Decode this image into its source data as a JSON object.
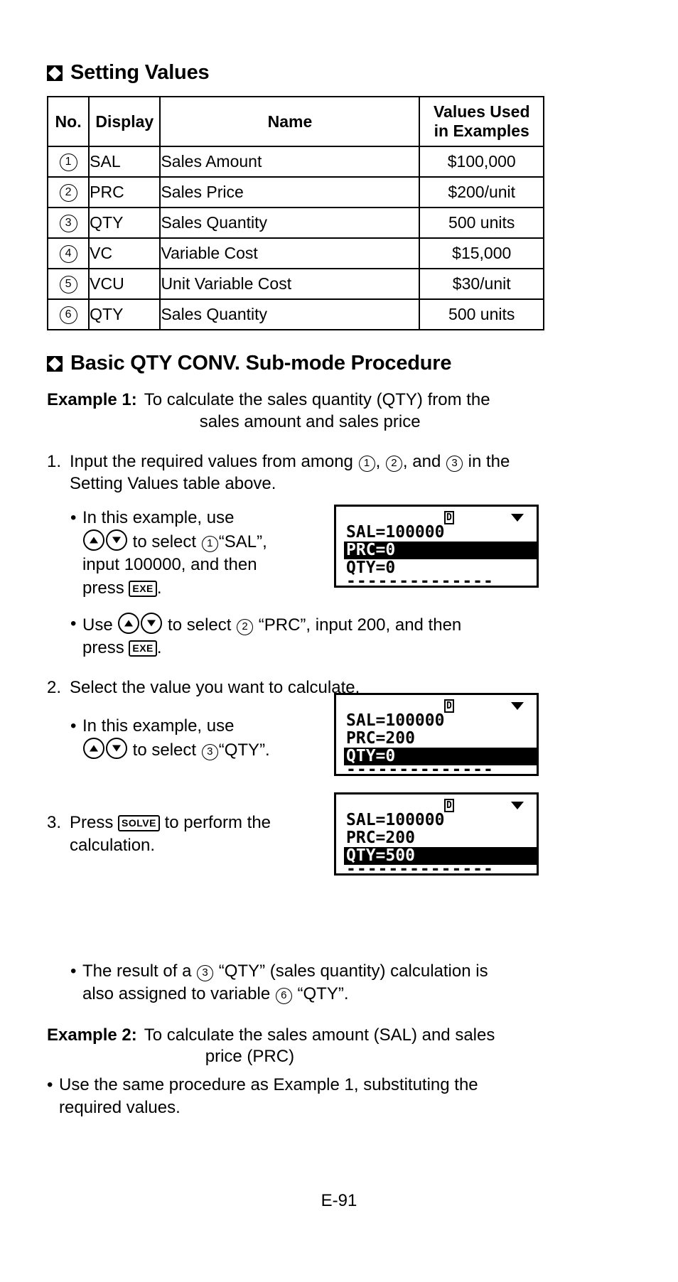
{
  "headings": {
    "setting_values": "Setting Values",
    "basic_procedure": "Basic QTY CONV. Sub-mode Procedure"
  },
  "table": {
    "columns": [
      "No.",
      "Display",
      "Name",
      "Values Used in Examples"
    ],
    "col_values_line1": "Values Used",
    "col_values_line2": "in Examples",
    "col_no": "No.",
    "col_display": "Display",
    "col_name": "Name",
    "rows": [
      {
        "no": "1",
        "display": "SAL",
        "name": "Sales Amount",
        "value": "$100,000"
      },
      {
        "no": "2",
        "display": "PRC",
        "name": "Sales Price",
        "value": "$200/unit"
      },
      {
        "no": "3",
        "display": "QTY",
        "name": "Sales Quantity",
        "value": "500 units"
      },
      {
        "no": "4",
        "display": "VC",
        "name": "Variable Cost",
        "value": "$15,000"
      },
      {
        "no": "5",
        "display": "VCU",
        "name": "Unit Variable Cost",
        "value": "$30/unit"
      },
      {
        "no": "6",
        "display": "QTY",
        "name": "Sales Quantity",
        "value": "500 units"
      }
    ]
  },
  "example1": {
    "label": "Example 1:",
    "text_line1": "To calculate the sales quantity (QTY) from the",
    "text_line2": "sales amount and sales price"
  },
  "step1": {
    "number": "1.",
    "text_before": "Input the required values from among",
    "circ_a": "1",
    "sep_a": ",",
    "circ_b": "2",
    "sep_b": ", and",
    "circ_c": "3",
    "text_after": "in the Setting Values table above."
  },
  "step1_bullet1": {
    "dot": "•",
    "seg1": "In this example, use",
    "key_up": "up-arrow",
    "key_down": "down-arrow",
    "seg2": "to select",
    "circ": "1",
    "seg3": "“SAL”,",
    "seg4": "input 100000, and then",
    "seg5": "press",
    "key_exe": "EXE",
    "seg6": "."
  },
  "step1_bullet2": {
    "dot": "•",
    "seg1": "Use",
    "key_up": "up-arrow",
    "key_down": "down-arrow",
    "seg2": "to select",
    "circ": "2",
    "seg3": "“PRC”, input 200, and then",
    "seg4": "press",
    "key_exe": "EXE",
    "seg5": "."
  },
  "step2": {
    "number": "2.",
    "text": "Select the value you want to calculate."
  },
  "step2_bullet": {
    "dot": "•",
    "seg1": "In this example, use",
    "key_up": "up-arrow",
    "key_down": "down-arrow",
    "seg2": "to select",
    "circ": "3",
    "seg3": "“QTY”."
  },
  "step3": {
    "number": "3.",
    "seg1": "Press",
    "key_solve": "SOLVE",
    "seg2": "to perform the",
    "seg3": "calculation."
  },
  "result_bullet": {
    "dot": "•",
    "seg1": "The result of a",
    "circ1": "3",
    "seg2": "“QTY” (sales quantity) calculation is",
    "seg3": "also assigned to variable",
    "circ2": "6",
    "seg4": "“QTY”."
  },
  "example2": {
    "label": "Example 2:",
    "text_line1": "To calculate the sales amount (SAL) and sales",
    "text_line2": "price (PRC)"
  },
  "example2_bullet": {
    "dot": "•",
    "line1": "Use the same procedure as Example 1, substituting the",
    "line2": "required values."
  },
  "lcd1": {
    "status_mode": "D",
    "status_arrow": "down-triangle",
    "line1": "SAL=100000",
    "line2": "PRC=0",
    "line3": "QTY=0",
    "line2_highlighted": true,
    "separator": "--------------"
  },
  "lcd2": {
    "status_mode": "D",
    "status_arrow": "down-triangle",
    "line1": "SAL=100000",
    "line2": "PRC=200",
    "line3": "QTY=0",
    "line3_highlighted": true,
    "separator": "--------------"
  },
  "lcd3": {
    "status_mode": "D",
    "status_arrow": "down-triangle",
    "line1": "SAL=100000",
    "line2": "PRC=200",
    "line3": "QTY=500",
    "line3_highlighted": true,
    "separator": "--------------"
  },
  "footer": {
    "page_number": "E-91"
  }
}
